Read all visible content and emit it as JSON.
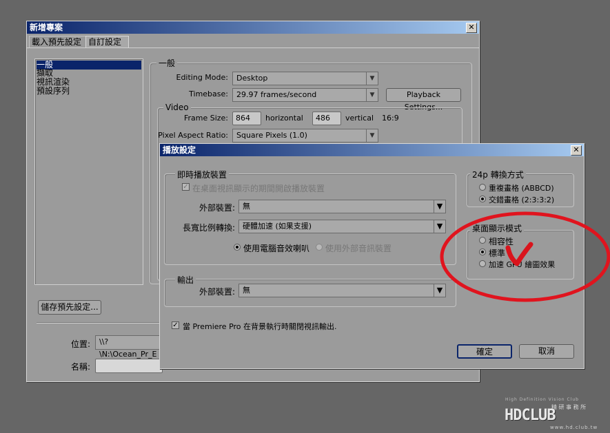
{
  "new_project": {
    "title": "新增專案",
    "tabs": [
      "載入預先設定",
      "自訂設定"
    ],
    "sidebar_items": [
      "一般",
      "擷取",
      "視訊渲染",
      "預設序列"
    ],
    "general_legend": "一般",
    "editing_mode_label": "Editing Mode:",
    "editing_mode_value": "Desktop",
    "timebase_label": "Timebase:",
    "timebase_value": "29.97 frames/second",
    "playback_settings_btn": "Playback Settings...",
    "video_legend": "Video",
    "frame_size_label": "Frame Size:",
    "frame_width": "864",
    "horizontal_label": "horizontal",
    "frame_height": "486",
    "vertical_label": "vertical",
    "aspect_ratio_text": "16:9",
    "pixel_aspect_label": "Pixel Aspect Ratio:",
    "pixel_aspect_value": "Square Pixels (1.0)",
    "save_preset_btn": "儲存預先設定...",
    "location_label": "位置:",
    "location_value": "\\\\?\\N:\\Ocean_Pr_E",
    "name_label": "名稱:"
  },
  "playback_settings": {
    "title": "播放設定",
    "realtime_legend": "即時播放裝置",
    "desktop_checkbox": "在桌面視訊顯示的期間開啟播放裝置",
    "external_device_label": "外部裝置:",
    "external_device_value": "無",
    "aspect_conversion_label": "長寬比例轉換:",
    "aspect_conversion_value": "硬體加速 (如果支援)",
    "use_computer_audio": "使用電腦音效喇叭",
    "use_external_audio": "使用外部音訊裝置",
    "output_legend": "輸出",
    "output_device_label": "外部裝置:",
    "output_device_value": "無",
    "pulldown_legend": "24p 轉換方式",
    "pulldown_options": [
      "重複畫格 (ABBCD)",
      "交錯畫格 (2:3:3:2)"
    ],
    "pulldown_selected": 1,
    "desktop_mode_legend": "桌面顯示模式",
    "desktop_mode_options": [
      "相容性",
      "標準",
      "加速 GPU 繪圖效果"
    ],
    "desktop_mode_selected": 1,
    "disable_output_checkbox": "當 Premiere Pro 在背景執行時關閉視訊輸出.",
    "ok_btn": "確定",
    "cancel_btn": "取消"
  },
  "annotation": {
    "circle_color": "#e0141e",
    "check_color": "#d9141c"
  },
  "watermark": {
    "tagline": "High Definition Vision Club",
    "chinese": "精 研 事 務 所",
    "logo_text": "HDCLUB",
    "url": "www.hd.club.tw"
  },
  "colors": {
    "title_bar_start": "#0a246a",
    "title_bar_end": "#a6caf0",
    "selection": "#0a246a",
    "panel": "#9b9b9b",
    "desktop": "#666666"
  }
}
